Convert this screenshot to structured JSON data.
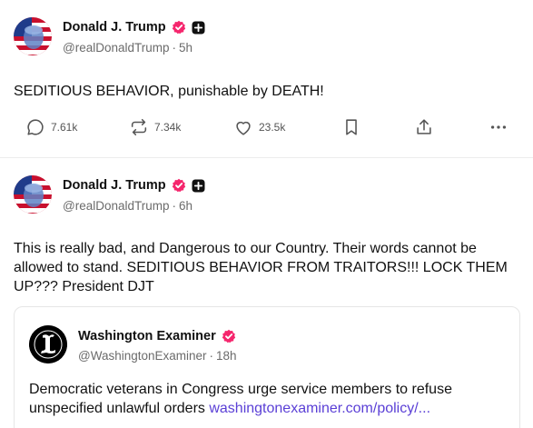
{
  "posts": [
    {
      "author": {
        "name": "Donald J. Trump",
        "handle": "@realDonaldTrump",
        "time": "5h"
      },
      "text": "SEDITIOUS BEHAVIOR, punishable by DEATH!",
      "stats": {
        "replies": "7.61k",
        "retruths": "7.34k",
        "likes": "23.5k"
      }
    },
    {
      "author": {
        "name": "Donald J. Trump",
        "handle": "@realDonaldTrump",
        "time": "6h"
      },
      "text": "This is really bad, and Dangerous to our Country. Their words cannot be allowed to stand. SEDITIOUS BEHAVIOR FROM TRAITORS!!! LOCK THEM UP??? President DJT",
      "quote": {
        "author": {
          "name": "Washington Examiner",
          "handle": "@WashingtonExaminer",
          "time": "18h"
        },
        "text": "Democratic veterans in Congress urge service members to refuse unspecified unlawful orders",
        "link": "washingtonexaminer.com/policy/..."
      }
    }
  ],
  "separator": "·",
  "colors": {
    "verified": "#f5266d",
    "link": "#5a3fd6",
    "muted": "#6b6b6b"
  },
  "icons": [
    "verified-badge-icon",
    "plus-badge-icon",
    "reply-icon",
    "retruth-icon",
    "like-icon",
    "bookmark-icon",
    "share-icon",
    "more-icon"
  ]
}
